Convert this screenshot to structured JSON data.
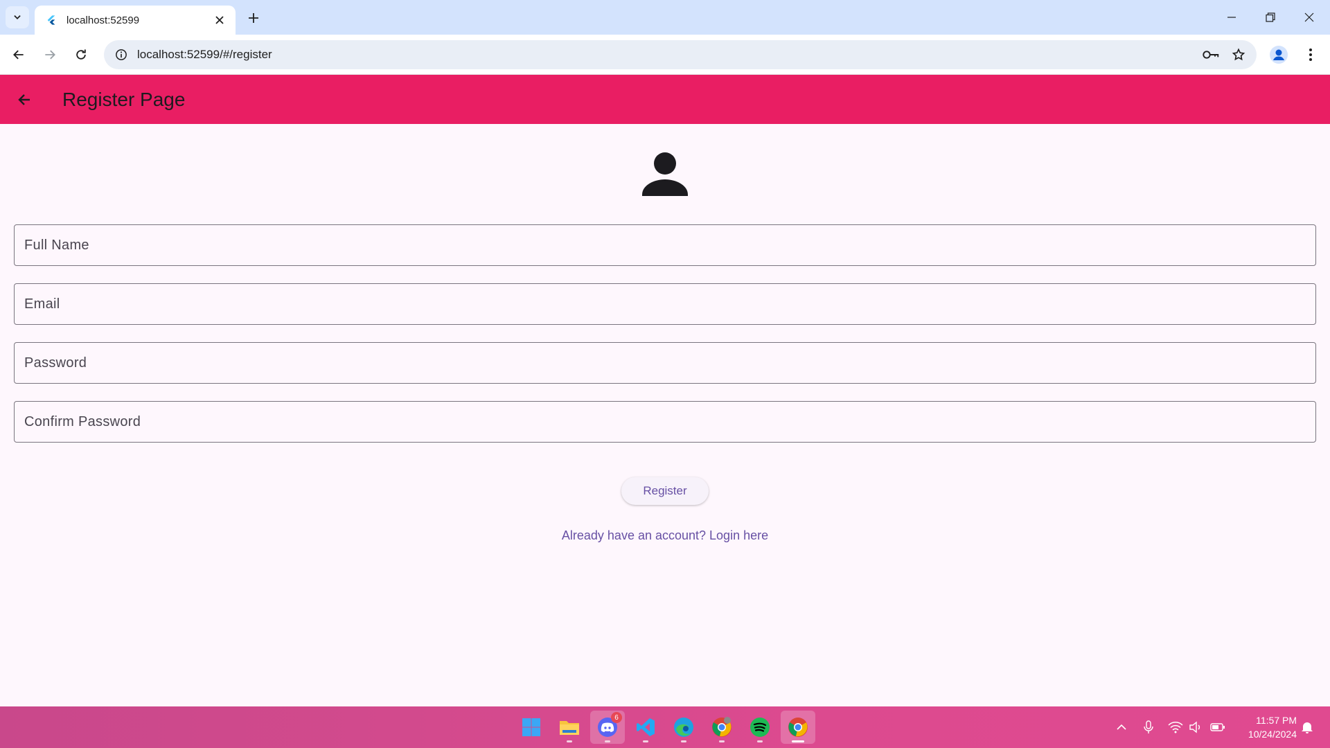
{
  "browser": {
    "tab_title": "localhost:52599",
    "url": "localhost:52599/#/register"
  },
  "appbar": {
    "title": "Register Page",
    "color": "#e91e63"
  },
  "form": {
    "full_name_placeholder": "Full Name",
    "email_placeholder": "Email",
    "password_placeholder": "Password",
    "confirm_password_placeholder": "Confirm Password",
    "register_label": "Register",
    "login_link": "Already have an account? Login here"
  },
  "taskbar": {
    "apps": [
      "windows-start",
      "file-explorer",
      "discord",
      "vscode",
      "edge",
      "chrome-profile",
      "spotify",
      "chrome"
    ],
    "discord_badge": "6",
    "time": "11:57 PM",
    "date": "10/24/2024"
  },
  "colors": {
    "accent": "#6750a4",
    "background": "#fef7fd",
    "outline": "#79747e"
  }
}
